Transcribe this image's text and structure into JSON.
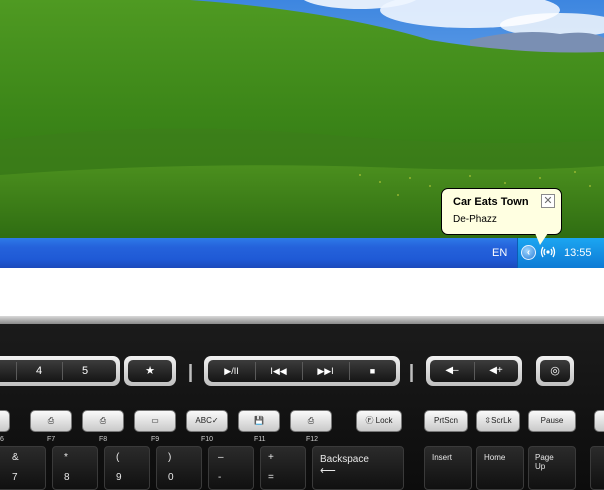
{
  "balloon": {
    "title": "Car Eats Town",
    "text": "De-Phazz",
    "close_glyph": "✕"
  },
  "taskbar": {
    "language": "EN",
    "expand_glyph": "‹",
    "network_icon": "wireless-icon",
    "clock": "13:55"
  },
  "keyboard": {
    "number_keys": [
      "4",
      "5"
    ],
    "favorite_glyph": "★",
    "media_keys": [
      "▶/II",
      "I◀◀",
      "▶▶I",
      "■"
    ],
    "volume_keys": [
      "◀–",
      "◀+"
    ],
    "mute_glyph": "◎",
    "fkeys": [
      {
        "label": "F7",
        "glyph": "⎙"
      },
      {
        "label": "F8",
        "glyph": "⎙"
      },
      {
        "label": "F9",
        "glyph": "▭"
      },
      {
        "label": "F10",
        "glyph": "ABC✓"
      },
      {
        "label": "F11",
        "glyph": "💾"
      },
      {
        "label": "F12",
        "glyph": "⎙"
      }
    ],
    "flock": "Ⓕ Lock",
    "prtscn": "PrtScn",
    "scrlk": "⇳ScrLk",
    "pause": "Pause",
    "fkey_partial_label": "6",
    "row_keys": [
      {
        "top": "&",
        "bottom": "7"
      },
      {
        "top": "*",
        "bottom": "8"
      },
      {
        "top": "(",
        "bottom": "9"
      },
      {
        "top": ")",
        "bottom": "0"
      },
      {
        "top": "–",
        "bottom": "-"
      },
      {
        "top": "+",
        "bottom": "="
      }
    ],
    "backspace": "Backspace",
    "backspace_arrow": "⟵",
    "insert": "Insert",
    "home": "Home",
    "page_up_1": "Page",
    "page_up_2": "Up"
  },
  "colors": {
    "taskbar_blue": "#2562db",
    "tray_blue": "#1590e3",
    "balloon_bg": "#ffffe1",
    "grass": "#3f8f1a",
    "sky": "#5b9be6"
  }
}
